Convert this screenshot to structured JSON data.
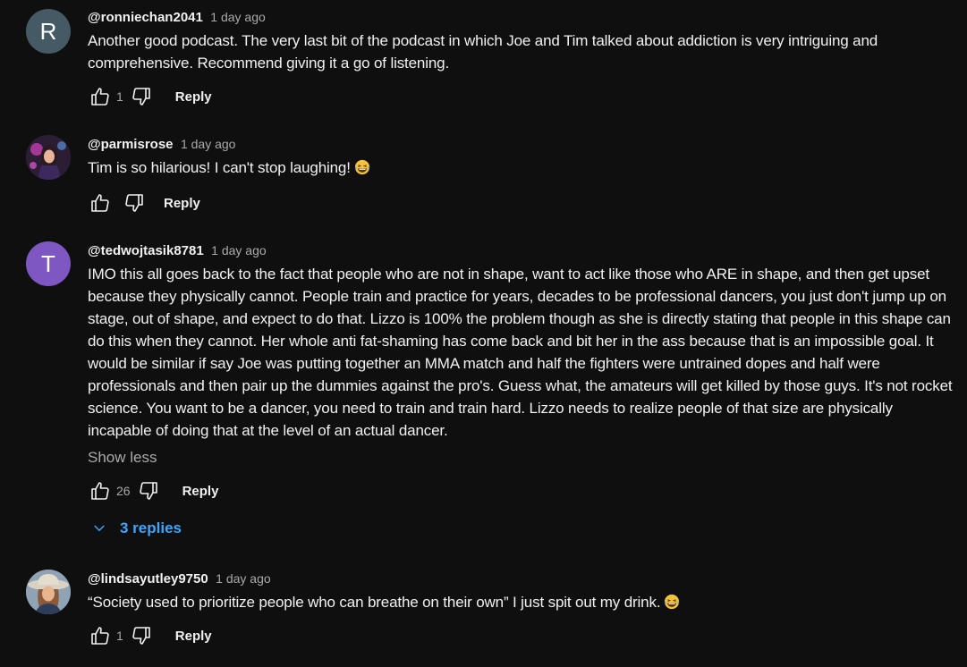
{
  "comments": [
    {
      "avatar_letter": "R",
      "avatar_color": "#455a64",
      "handle": "@ronniechan2041",
      "time": "1 day ago",
      "text": "Another good podcast. The very last bit of the podcast in which Joe and Tim talked about addiction is very intriguing and comprehensive. Recommend giving it a go of listening.",
      "likes": "1",
      "reply_label": "Reply"
    },
    {
      "avatar_icon": "profile-photo",
      "handle": "@parmisrose",
      "time": "1 day ago",
      "text": "Tim is so hilarious! I can't stop laughing!",
      "emoji": "laughing-emoji",
      "likes": "",
      "reply_label": "Reply"
    },
    {
      "avatar_letter": "T",
      "avatar_color": "#7e57c2",
      "handle": "@tedwojtasik8781",
      "time": "1 day ago",
      "text": "IMO this all goes back to the fact that people who are not in shape, want to act like those who ARE in shape, and then get upset because they physically cannot. People train and practice for years, decades to be professional dancers, you just don't jump up on stage, out of shape, and expect to do that. Lizzo is 100% the problem though as she is directly stating that people in this shape can do this when they cannot. Her whole anti fat-shaming has come back and bit her in the ass because that is an impossible goal. It would be similar if say Joe was putting together an MMA match and half the fighters were untrained dopes and half were professionals and then pair up the dummies against the pro's. Guess what, the amateurs will get killed by those guys. It's not rocket science. You want to be a dancer, you need to train and train hard. Lizzo needs to realize people of that size are physically incapable of doing that at the level of an actual dancer.",
      "show_less": "Show less",
      "likes": "26",
      "reply_label": "Reply",
      "replies_label": "3 replies"
    },
    {
      "avatar_icon": "profile-photo",
      "handle": "@lindsayutley9750",
      "time": "1 day ago",
      "text": "“Society used to prioritize people who can breathe on their own” I just spit out my drink.",
      "emoji": "laughing-emoji",
      "likes": "1",
      "reply_label": "Reply"
    }
  ],
  "icons": {
    "like": "thumbs-up-icon",
    "dislike": "thumbs-down-icon",
    "expand": "chevron-down-icon"
  },
  "colors": {
    "background": "#0f0f0f",
    "text_primary": "#f1f1f1",
    "text_secondary": "#aaaaaa",
    "link_blue": "#3ea6ff"
  }
}
